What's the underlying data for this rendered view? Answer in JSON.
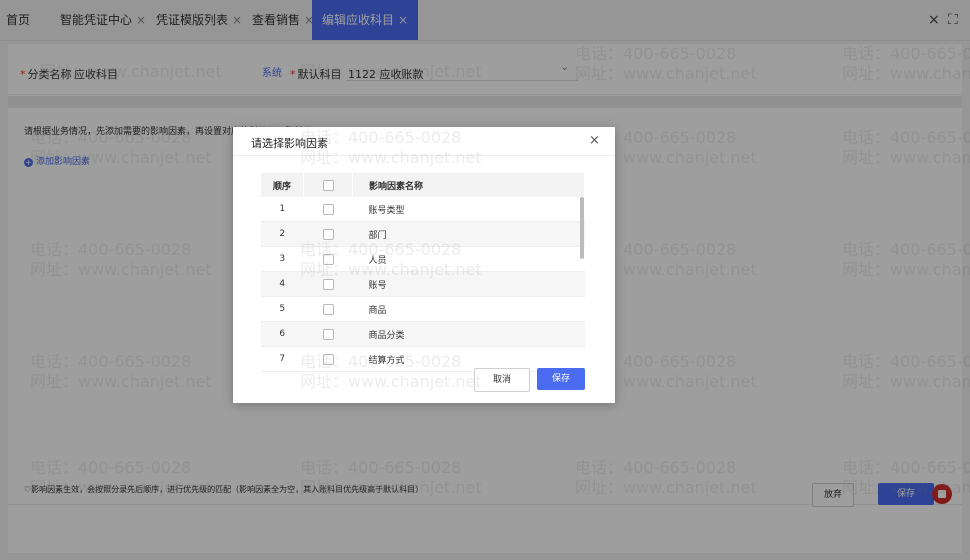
{
  "tabs": [
    {
      "label": "首页",
      "closable": false,
      "active": false
    },
    {
      "label": "智能凭证中心",
      "closable": true,
      "active": false
    },
    {
      "label": "凭证模版列表",
      "closable": true,
      "active": false
    },
    {
      "label": "查看销售",
      "closable": true,
      "active": false
    },
    {
      "label": "编辑应收科目",
      "closable": true,
      "active": true
    }
  ],
  "tab_close_glyph": "×",
  "window_controls": {
    "close": "×",
    "fullscreen": "⛶"
  },
  "form": {
    "category_label": "分类名称",
    "category_value": "应收科目",
    "system_tag": "系统",
    "default_subject_label": "默认科目",
    "default_subject_value": "1122 应收账款",
    "required_mark": "*"
  },
  "hint_text": "请根据业务情况，先添加需要的影响因素，再设置对应的科目及入账科目",
  "add_factor_label": "添加影响因素",
  "bottom_note": "影响因素生效，会按照分录先后顺序，进行优先级的匹配（影响因素全为空，其入账科目优先级高于默认科目）",
  "footer": {
    "abandon_label": "放弃",
    "save_label": "保存"
  },
  "dialog": {
    "title": "请选择影响因素",
    "close": "×",
    "columns": [
      "顺序",
      "",
      "影响因素名称"
    ],
    "rows": [
      {
        "no": "1",
        "name": "账号类型"
      },
      {
        "no": "2",
        "name": "部门"
      },
      {
        "no": "3",
        "name": "人员"
      },
      {
        "no": "4",
        "name": "账号"
      },
      {
        "no": "5",
        "name": "商品"
      },
      {
        "no": "6",
        "name": "商品分类"
      },
      {
        "no": "7",
        "name": "结算方式"
      }
    ],
    "cancel_label": "取消",
    "save_label": "保存"
  },
  "watermark": {
    "phone": "电话：400-665-0028",
    "site": "网址：www.chanjet.net"
  },
  "colors": {
    "accent": "#4b6cf0",
    "record": "#d02d2d"
  }
}
